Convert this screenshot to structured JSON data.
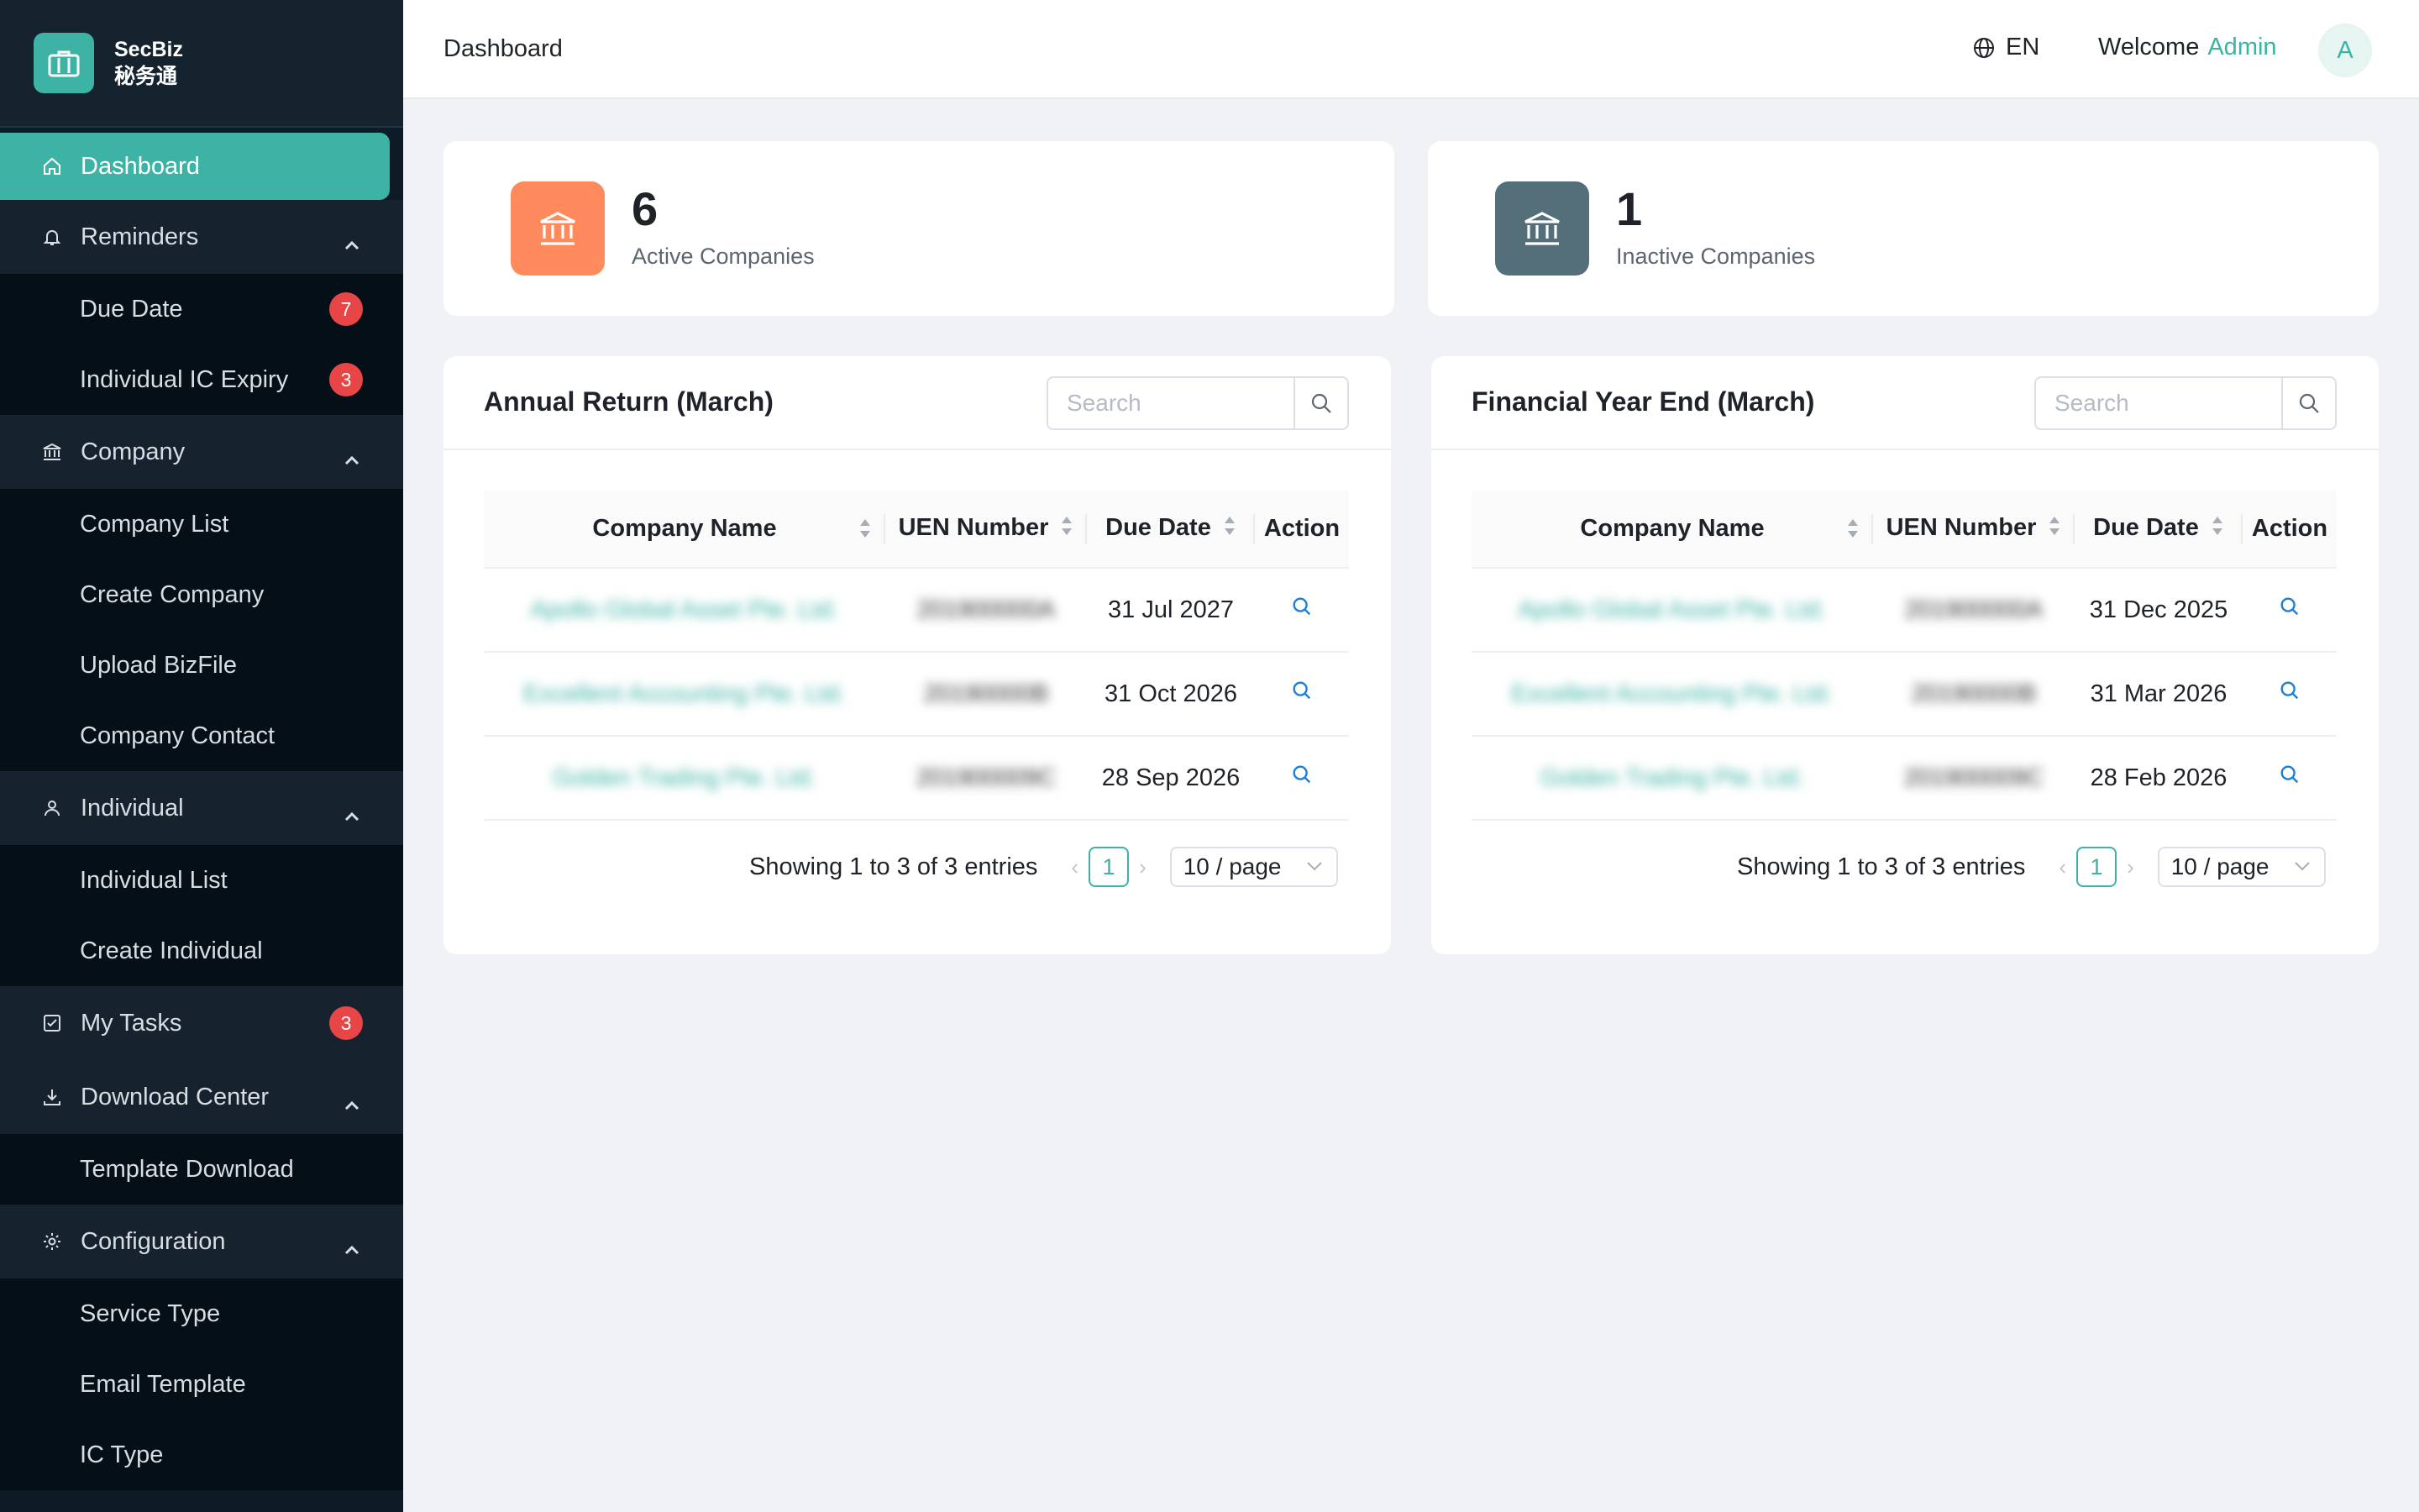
{
  "brand": {
    "name": "SecBiz",
    "subtitle": "秘务通"
  },
  "sidebar": {
    "dashboard": "Dashboard",
    "reminders": {
      "label": "Reminders",
      "due_date": "Due Date",
      "due_date_badge": "7",
      "ic_expiry": "Individual IC Expiry",
      "ic_expiry_badge": "3"
    },
    "company": {
      "label": "Company",
      "list": "Company List",
      "create": "Create Company",
      "upload": "Upload BizFile",
      "contact": "Company Contact"
    },
    "individual": {
      "label": "Individual",
      "list": "Individual List",
      "create": "Create Individual"
    },
    "tasks": {
      "label": "My Tasks",
      "badge": "3"
    },
    "download": {
      "label": "Download Center",
      "template": "Template Download"
    },
    "config": {
      "label": "Configuration",
      "service_type": "Service Type",
      "email_template": "Email Template",
      "ic_type": "IC Type"
    }
  },
  "header": {
    "breadcrumb": "Dashboard",
    "lang": "EN",
    "welcome": "Welcome",
    "user": "Admin",
    "avatar_initial": "A"
  },
  "stats": {
    "active": {
      "value": "6",
      "label": "Active Companies",
      "color": "#ff8a5b"
    },
    "inactive": {
      "value": "1",
      "label": "Inactive Companies",
      "color": "#546e7a"
    }
  },
  "table_columns": {
    "company": "Company Name",
    "uen": "UEN Number",
    "due": "Due Date",
    "action": "Action"
  },
  "annual_return": {
    "title": "Annual Return (March)",
    "search_placeholder": "Search",
    "rows": [
      {
        "company": "Apollo Global Asset Pte. Ltd.",
        "uen": "201900000A",
        "due": "31 Jul 2027"
      },
      {
        "company": "Excellent Accounting Pte. Ltd.",
        "uen": "20190000B",
        "due": "31 Oct 2026"
      },
      {
        "company": "Golden Trading Pte. Ltd.",
        "uen": "201900009C",
        "due": "28 Sep 2026"
      }
    ],
    "pagination": {
      "info": "Showing 1 to 3 of 3 entries",
      "page": "1",
      "size": "10 / page"
    }
  },
  "financial_year_end": {
    "title": "Financial Year End (March)",
    "search_placeholder": "Search",
    "rows": [
      {
        "company": "Apollo Global Asset Pte. Ltd.",
        "uen": "201900000A",
        "due": "31 Dec 2025"
      },
      {
        "company": "Excellent Accounting Pte. Ltd.",
        "uen": "20190000B",
        "due": "31 Mar 2026"
      },
      {
        "company": "Golden Trading Pte. Ltd.",
        "uen": "201900009C",
        "due": "28 Feb 2026"
      }
    ],
    "pagination": {
      "info": "Showing 1 to 3 of 3 entries",
      "page": "1",
      "size": "10 / page"
    }
  },
  "theme": {
    "accent": "#3cb3a5",
    "sidebar_bg": "#0d1b26",
    "badge": "#e84646"
  }
}
